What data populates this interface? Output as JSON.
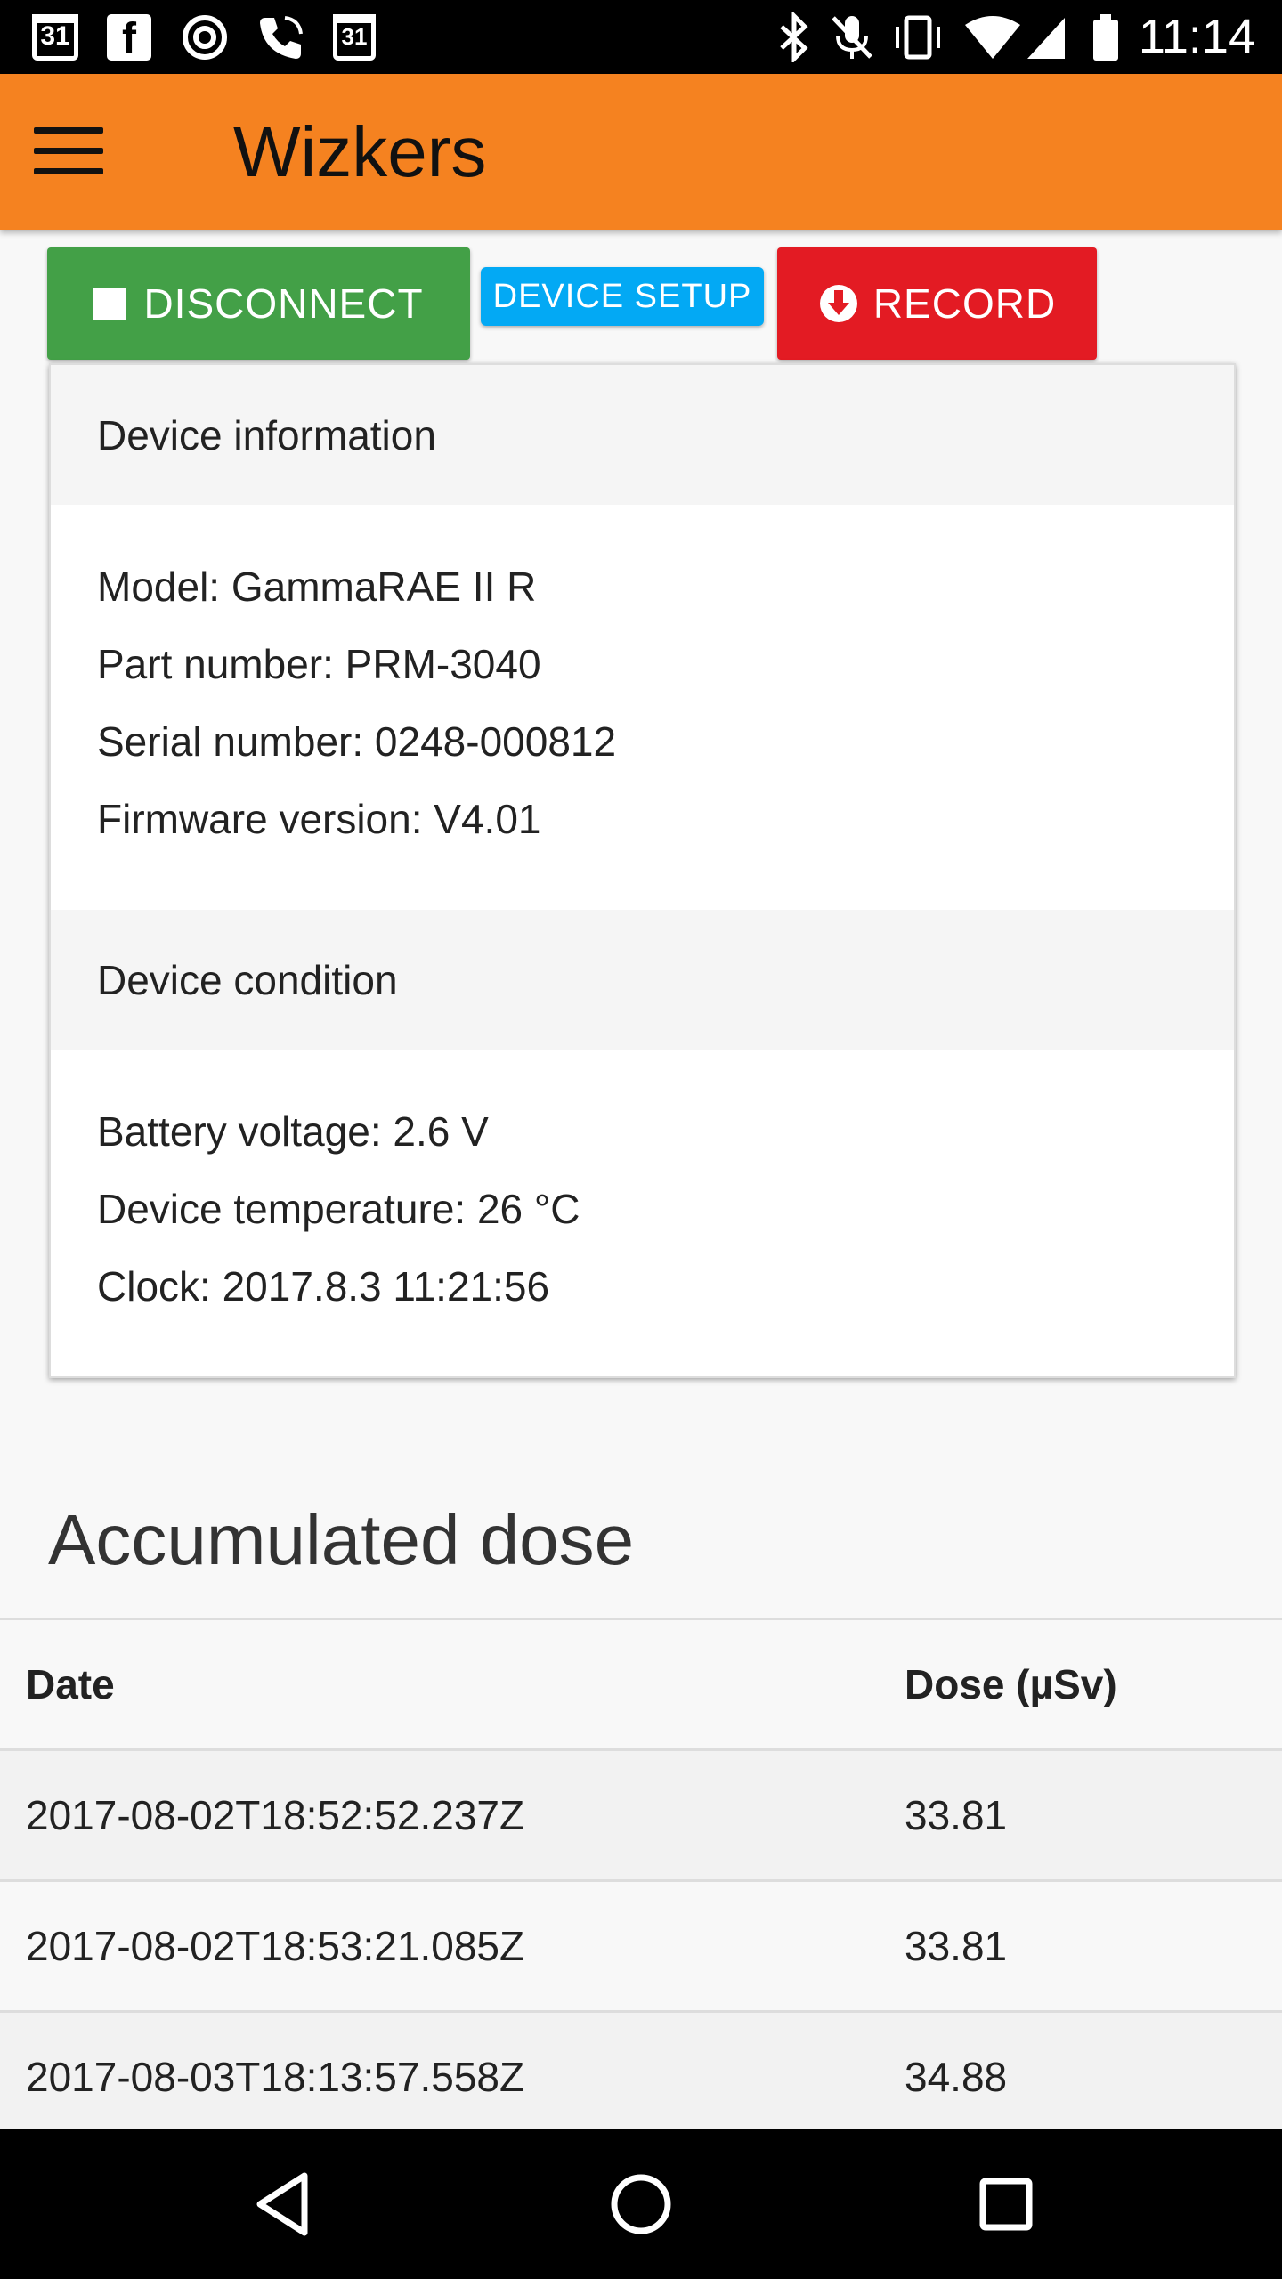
{
  "status_bar": {
    "calendar_day_1": "31",
    "facebook_glyph": "f",
    "calendar_day_2": "31",
    "time": "11:14",
    "icons": [
      "calendar-icon",
      "facebook-icon",
      "sync-icon",
      "phone-icon",
      "calendar-icon",
      "bluetooth-icon",
      "mute-mic-icon",
      "vibrate-icon",
      "wifi-icon",
      "signal-icon",
      "battery-icon"
    ]
  },
  "app_bar": {
    "title": "Wizkers",
    "menu_icon": "hamburger-menu-icon"
  },
  "toolbar": {
    "disconnect_label": "DISCONNECT",
    "device_setup_label": "DEVICE SETUP",
    "record_label": "RECORD"
  },
  "device_information": {
    "heading": "Device information",
    "model": "Model: GammaRAE II R",
    "part_number": "Part number: PRM-3040",
    "serial_number": "Serial number: 0248-000812",
    "firmware_version": "Firmware version: V4.01"
  },
  "device_condition": {
    "heading": "Device condition",
    "battery_voltage": "Battery voltage: 2.6 V",
    "temperature": "Device temperature: 26 °C",
    "clock": "Clock: 2017.8.3 11:21:56"
  },
  "accumulated_dose": {
    "title": "Accumulated dose",
    "columns": [
      "Date",
      "Dose (µSv)"
    ],
    "rows": [
      [
        "2017-08-02T18:52:52.237Z",
        "33.81"
      ],
      [
        "2017-08-02T18:53:21.085Z",
        "33.81"
      ],
      [
        "2017-08-03T18:13:57.558Z",
        "34.88"
      ]
    ]
  },
  "colors": {
    "app_bar": "#f58220",
    "disconnect": "#43a047",
    "device_setup": "#03a9f4",
    "record": "#e31b23"
  }
}
